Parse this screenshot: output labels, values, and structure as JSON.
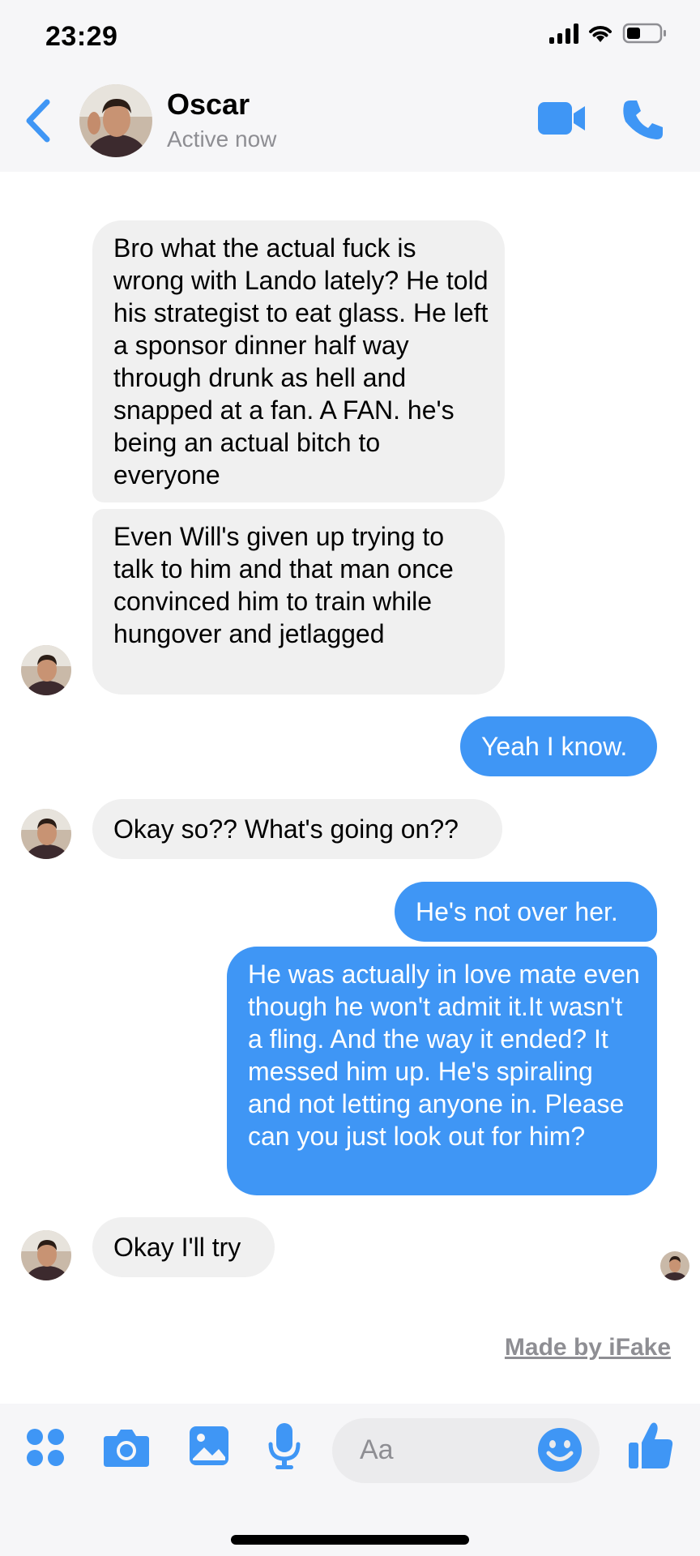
{
  "status_bar": {
    "time": "23:29"
  },
  "header": {
    "contact_name": "Oscar",
    "contact_status": "Active now"
  },
  "messages": [
    {
      "side": "in",
      "text": "Bro what the actual fuck is wrong with Lando lately? He told his strategist to eat glass. He left a sponsor dinner half way through drunk as hell and snapped at a fan. A FAN. he's being an actual bitch to everyone"
    },
    {
      "side": "in",
      "text": "Even Will's given up trying to talk to him and that man once convinced him to train while hungover and jetlagged"
    },
    {
      "side": "out",
      "text": "Yeah I know."
    },
    {
      "side": "in",
      "text": "Okay so?? What's going on??"
    },
    {
      "side": "out",
      "text": "He's not over her."
    },
    {
      "side": "out",
      "text": "He was actually in love mate even though he won't admit it.It wasn't a fling. And the way it ended? It messed him up. He's spiraling and not letting anyone in. Please can you just look out for him?"
    },
    {
      "side": "in",
      "text": "Okay I'll try"
    }
  ],
  "watermark": "Made by iFake",
  "composer": {
    "placeholder": "Aa"
  },
  "colors": {
    "accent": "#3f96f5",
    "incoming_bubble": "#f0f0f0",
    "bar_bg": "#f6f6f8"
  }
}
